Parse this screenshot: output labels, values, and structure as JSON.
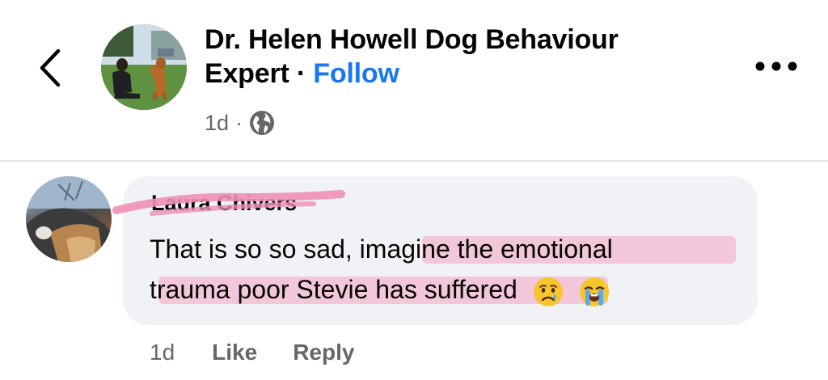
{
  "header": {
    "page_name": "Dr. Helen Howell Dog Behaviour Expert",
    "separator": "·",
    "follow_label": "Follow",
    "timestamp": "1d",
    "meta_separator": "·",
    "icons": {
      "back": "chevron-left-icon",
      "audience": "globe-icon",
      "more": "more-options-icon"
    }
  },
  "comment": {
    "author": "Laura Chivers",
    "text_line1": "That is so so sad, imagine the emotional",
    "text_line2": "trauma poor Stevie has suffered",
    "emojis": [
      "crying-face-emoji",
      "loudly-crying-face-emoji"
    ],
    "timestamp": "1d",
    "like_label": "Like",
    "reply_label": "Reply"
  },
  "colors": {
    "link": "#1877f2",
    "secondary_text": "#65676b",
    "bubble": "#f0f2f5",
    "highlight": "#f2b8cf"
  }
}
